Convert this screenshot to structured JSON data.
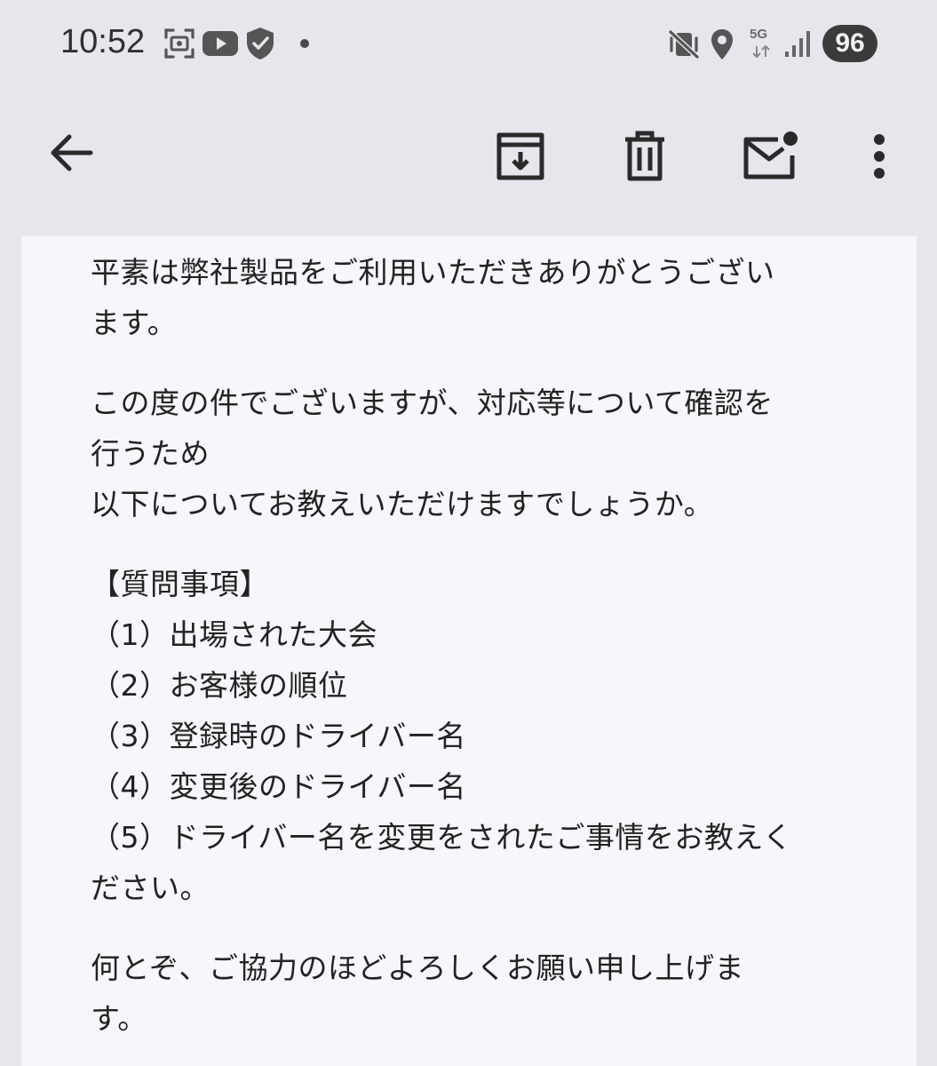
{
  "status_bar": {
    "time": "10:52",
    "network_label": "5G",
    "battery": "96",
    "icons": [
      "screenshot-icon",
      "youtube-icon",
      "shield-icon",
      "vibrate-icon",
      "location-icon",
      "signal-icon"
    ]
  },
  "app_bar": {
    "icons": [
      "back-arrow-icon",
      "archive-icon",
      "trash-icon",
      "mark-unread-icon",
      "more-vert-icon"
    ]
  },
  "email": {
    "greeting": [
      "平素は弊社製品をご利用いただきありがとうござい",
      "ます。"
    ],
    "paragraph2": [
      "この度の件でございますが、対応等について確認を",
      "行うため",
      "以下についてお教えいただけますでしょうか。"
    ],
    "questions_heading": "【質問事項】",
    "questions": [
      "（1）出場された大会",
      "（2）お客様の順位",
      "（3）登録時のドライバー名",
      "（4）変更後のドライバー名",
      "（5）ドライバー名を変更をされたご事情をお教えく"
    ],
    "question5_cont": "ださい。",
    "closing": [
      "何とぞ、ご協力のほどよろしくお願い申し上げま",
      "す。"
    ]
  },
  "colors": {
    "background": "#e6e6ec",
    "content_bg": "#f6f6fb",
    "icon": "#2a2a2a"
  }
}
